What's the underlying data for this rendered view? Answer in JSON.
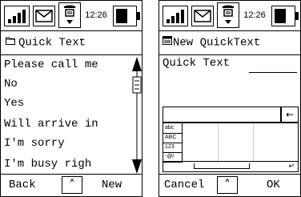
{
  "screens": [
    {
      "status": {
        "time": "12:26"
      },
      "title": "Quick Text",
      "items": [
        "Please call me",
        "No",
        "Yes",
        "Will arrive in",
        "I'm sorry",
        "I'm busy righ"
      ],
      "softkeys": {
        "left": "Back",
        "right": "New"
      }
    },
    {
      "status": {
        "time": "12:26"
      },
      "title": "New QuickText",
      "field_label": "Quick Text",
      "keyboard": {
        "modes": [
          "abc",
          "ABC",
          "123",
          "-@/"
        ]
      },
      "softkeys": {
        "left": "Cancel",
        "right": "OK"
      }
    }
  ],
  "icons": {
    "signal": "signal-strength-icon",
    "mail": "envelope-icon",
    "phone": "phone-icon",
    "battery": "battery-icon",
    "folder": "folder-icon",
    "compose": "compose-icon",
    "up": "chevron-up-icon",
    "backspace": "backspace-icon",
    "enter": "enter-icon"
  }
}
